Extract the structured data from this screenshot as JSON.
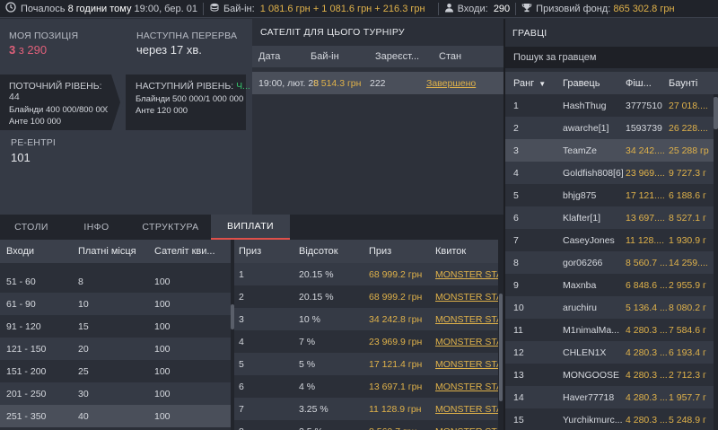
{
  "topbar": {
    "started_prefix": "Почалось",
    "started_highlight": "8 години тому",
    "started_suffix": "19:00, бер. 01",
    "buyin_label": "Бай-ін:",
    "buyin_value": "1 081.6 грн + 1 081.6 грн + 216.3 грн",
    "entries_label": "Входи:",
    "entries_value": "290",
    "prize_label": "Призовий фонд:",
    "prize_value": "865 302.8 грн"
  },
  "status": {
    "my_position_label": "МОЯ ПОЗИЦІЯ",
    "my_position_rank": "3",
    "my_position_of": "з 290",
    "next_break_label": "НАСТУПНА ПЕРЕРВА",
    "next_break_value": "через 17 хв.",
    "current_level_label": "ПОТОЧНИЙ РІВЕНЬ: 44",
    "current_blinds": "Блайнди 400 000/800 000",
    "current_ante": "Анте 100 000",
    "next_level_label": "НАСТУПНИЙ РІВЕНЬ: ",
    "next_level_timer": "Ч...",
    "next_blinds": "Блайнди 500 000/1 000 000",
    "next_ante": "Анте 120 000",
    "reentries_label": "РЕ-ЕНТРІ",
    "reentries_value": "101"
  },
  "satellite": {
    "title": "САТЕЛІТ ДЛЯ ЦЬОГО ТУРНІРУ",
    "headers": [
      "Дата",
      "Бай-ін",
      "Зареєст...",
      "Стан"
    ],
    "row": {
      "date": "19:00, лют. 28",
      "buyin": "8 514.3 грн",
      "registered": "222",
      "status": "Завершено"
    }
  },
  "tabs": [
    "СТОЛИ",
    "ІНФО",
    "СТРУКТУРА",
    "ВИПЛАТИ"
  ],
  "payout_tiers": {
    "headers": [
      "Входи",
      "Платні місця",
      "Сателіт кви..."
    ],
    "rows": [
      [
        "51 - 60",
        "8",
        "100"
      ],
      [
        "61 - 90",
        "10",
        "100"
      ],
      [
        "91 - 120",
        "15",
        "100"
      ],
      [
        "121 - 150",
        "20",
        "100"
      ],
      [
        "151 - 200",
        "25",
        "100"
      ],
      [
        "201 - 250",
        "30",
        "100"
      ],
      [
        "251 - 350",
        "40",
        "100"
      ]
    ]
  },
  "prizes": {
    "headers": [
      "Приз",
      "Відсоток",
      "Приз",
      "Квиток"
    ],
    "rows": [
      [
        "1",
        "20.15 %",
        "68 999.2 грн",
        "MONSTER STAC"
      ],
      [
        "2",
        "20.15 %",
        "68 999.2 грн",
        "MONSTER STAC"
      ],
      [
        "3",
        "10 %",
        "34 242.8 грн",
        "MONSTER STAC"
      ],
      [
        "4",
        "7 %",
        "23 969.9 грн",
        "MONSTER STAC"
      ],
      [
        "5",
        "5 %",
        "17 121.4 грн",
        "MONSTER STAC"
      ],
      [
        "6",
        "4 %",
        "13 697.1 грн",
        "MONSTER STAC"
      ],
      [
        "7",
        "3.25 %",
        "11 128.9 грн",
        "MONSTER STAC"
      ],
      [
        "8",
        "2.5 %",
        "8 560.7 грн",
        "MONSTER STAC"
      ]
    ]
  },
  "players": {
    "title": "ГРАВЦІ",
    "search_placeholder": "Пошук за гравцем",
    "headers": [
      "Ранг",
      "Гравець",
      "Фіш...",
      "Баунті"
    ],
    "rows": [
      [
        "1",
        "HashThug",
        "3777510",
        "27 018...."
      ],
      [
        "2",
        "awarche[1]",
        "1593739",
        "26 228...."
      ],
      [
        "3",
        "TeamZe",
        "34 242....",
        "25 288 гр"
      ],
      [
        "4",
        "Goldfish808[6]",
        "23 969....",
        "9 727.3 г"
      ],
      [
        "5",
        "bhjg875",
        "17 121....",
        "6 188.6 г"
      ],
      [
        "6",
        "Klafter[1]",
        "13 697....",
        "8 527.1 г"
      ],
      [
        "7",
        "CaseyJones",
        "11 128....",
        "1 930.9 г"
      ],
      [
        "8",
        "gor06266",
        "8 560.7 ...",
        "14 259...."
      ],
      [
        "9",
        "Maxnba",
        "6 848.6 ...",
        "2 955.9 г"
      ],
      [
        "10",
        "aruchiru",
        "5 136.4 ...",
        "8 080.2 г"
      ],
      [
        "11",
        "M1nimalMa...",
        "4 280.3 ...",
        "7 584.6 г"
      ],
      [
        "12",
        "CHLEN1X",
        "4 280.3 ...",
        "6 193.4 г"
      ],
      [
        "13",
        "MONGOOSE",
        "4 280.3 ...",
        "2 712.3 г"
      ],
      [
        "14",
        "Haver77718",
        "4 280.3 ...",
        "1 957.7 г"
      ],
      [
        "15",
        "Yurchikmurc...",
        "4 280.3 ...",
        "5 248.9 г"
      ]
    ]
  }
}
